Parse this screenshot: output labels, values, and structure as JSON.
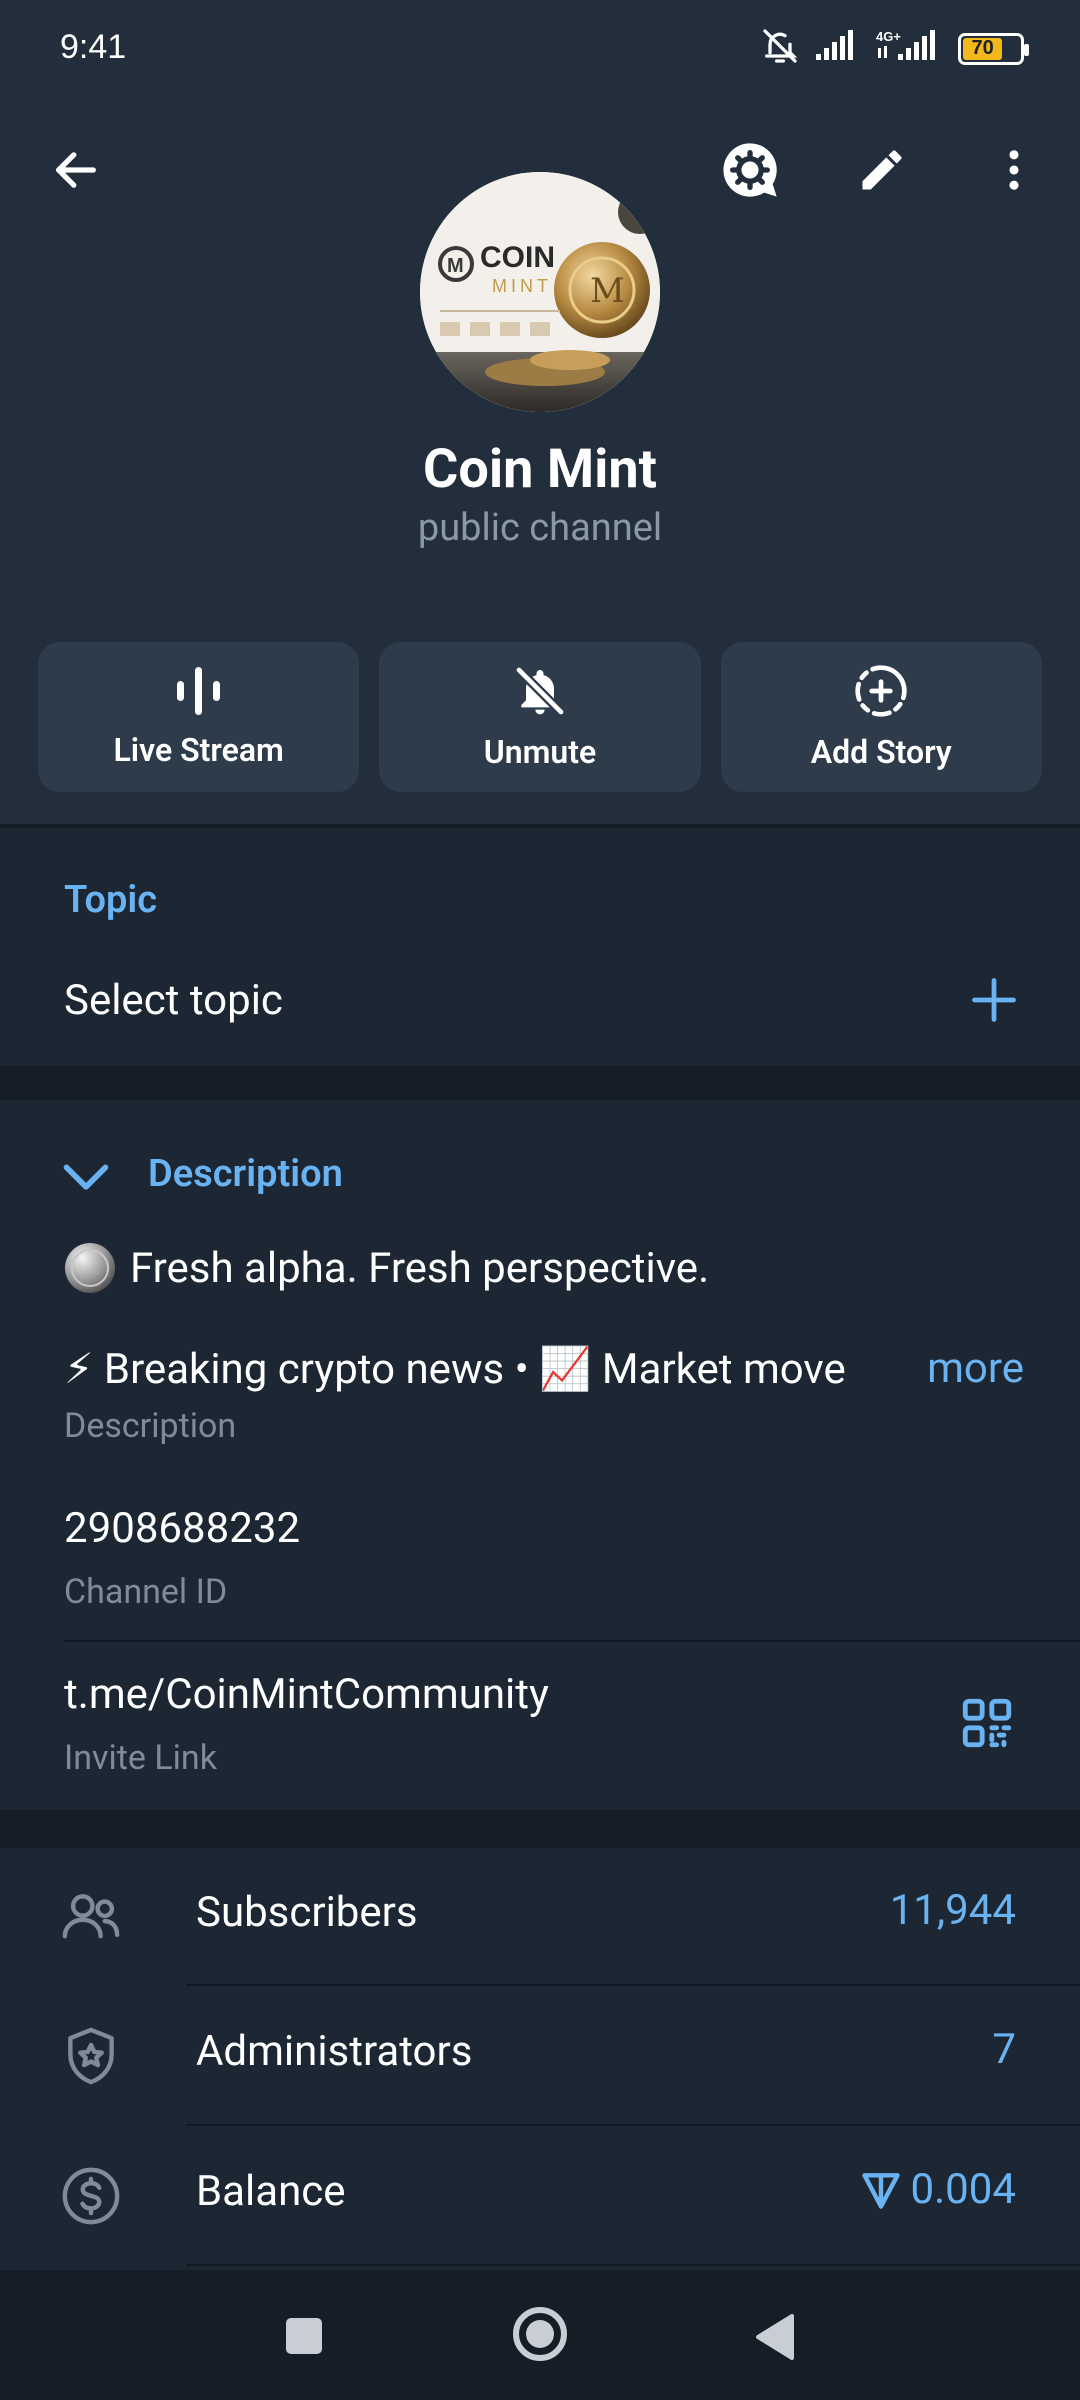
{
  "status_bar": {
    "time": "9:41",
    "battery": "70"
  },
  "header": {
    "channel_name": "Coin Mint",
    "channel_type": "public channel",
    "avatar_text_1": "COIN",
    "avatar_text_2": "MINT"
  },
  "actions": [
    {
      "label": "Live Stream",
      "icon": "live-stream-icon"
    },
    {
      "label": "Unmute",
      "icon": "bell-off-icon"
    },
    {
      "label": "Add Story",
      "icon": "add-story-icon"
    }
  ],
  "topic": {
    "heading": "Topic",
    "select_label": "Select topic"
  },
  "description": {
    "heading": "Description",
    "line1": "Fresh alpha. Fresh perspective.",
    "line2": "⚡ Breaking crypto news • 📈 Market move",
    "more_label": "more",
    "caption": "Description"
  },
  "channel_id": {
    "value": "2908688232",
    "caption": "Channel ID"
  },
  "invite_link": {
    "value": "t.me/CoinMintCommunity",
    "caption": "Invite Link"
  },
  "stats": [
    {
      "label": "Subscribers",
      "value": "11,944",
      "icon": "people-icon"
    },
    {
      "label": "Administrators",
      "value": "7",
      "icon": "shield-star-icon"
    },
    {
      "label": "Balance",
      "value": "0.004",
      "icon": "dollar-circle-icon"
    }
  ],
  "colors": {
    "accent": "#6ab3f3",
    "background": "#1d2733",
    "header": "#222e3b"
  }
}
